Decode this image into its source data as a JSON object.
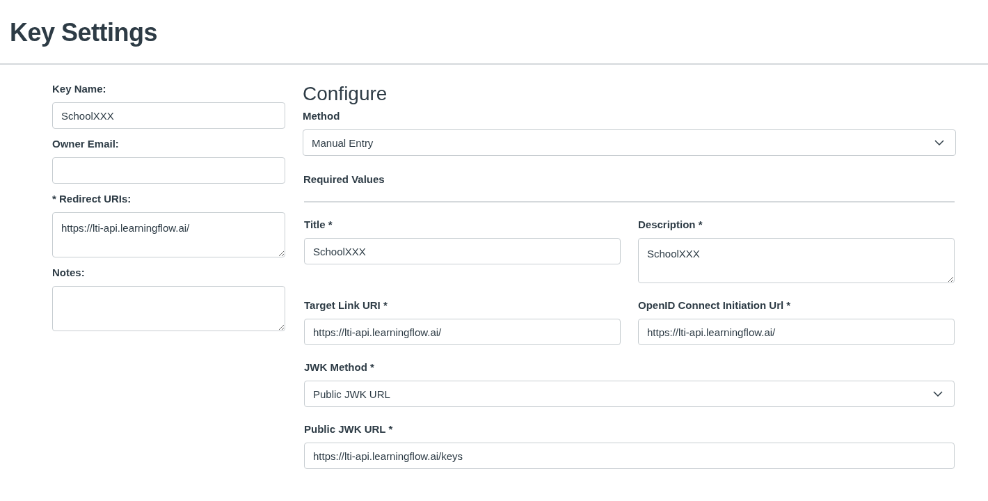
{
  "page": {
    "title": "Key Settings"
  },
  "key_form": {
    "fields": [
      {
        "kind": "input",
        "label": "Key Name:",
        "value": "SchoolXXX"
      },
      {
        "kind": "input",
        "label": "Owner Email:"
      },
      {
        "kind": "textarea",
        "label": "* Redirect URIs:",
        "value": "https://lti-api.learningflow.ai/"
      },
      {
        "kind": "textarea",
        "label": "Notes:"
      }
    ]
  },
  "configure": {
    "heading": "Configure",
    "method": {
      "kind": "select",
      "label": "Method",
      "value": "Manual Entry"
    },
    "section_title": "Required Values",
    "rows": [
      [
        {
          "kind": "input",
          "label": "Title *",
          "value": "SchoolXXX"
        },
        {
          "kind": "textarea",
          "label": "Description *",
          "value": "SchoolXXX"
        }
      ],
      [
        {
          "kind": "input",
          "label": "Target Link URI *",
          "value": "https://lti-api.learningflow.ai/"
        },
        {
          "kind": "input",
          "label": "OpenID Connect Initiation Url *",
          "value": "https://lti-api.learningflow.ai/"
        }
      ],
      [
        {
          "kind": "select",
          "label": "JWK Method *",
          "value": "Public JWK URL"
        }
      ],
      [
        {
          "kind": "input",
          "label": "Public JWK URL *",
          "value": "https://lti-api.learningflow.ai/keys"
        }
      ]
    ]
  }
}
